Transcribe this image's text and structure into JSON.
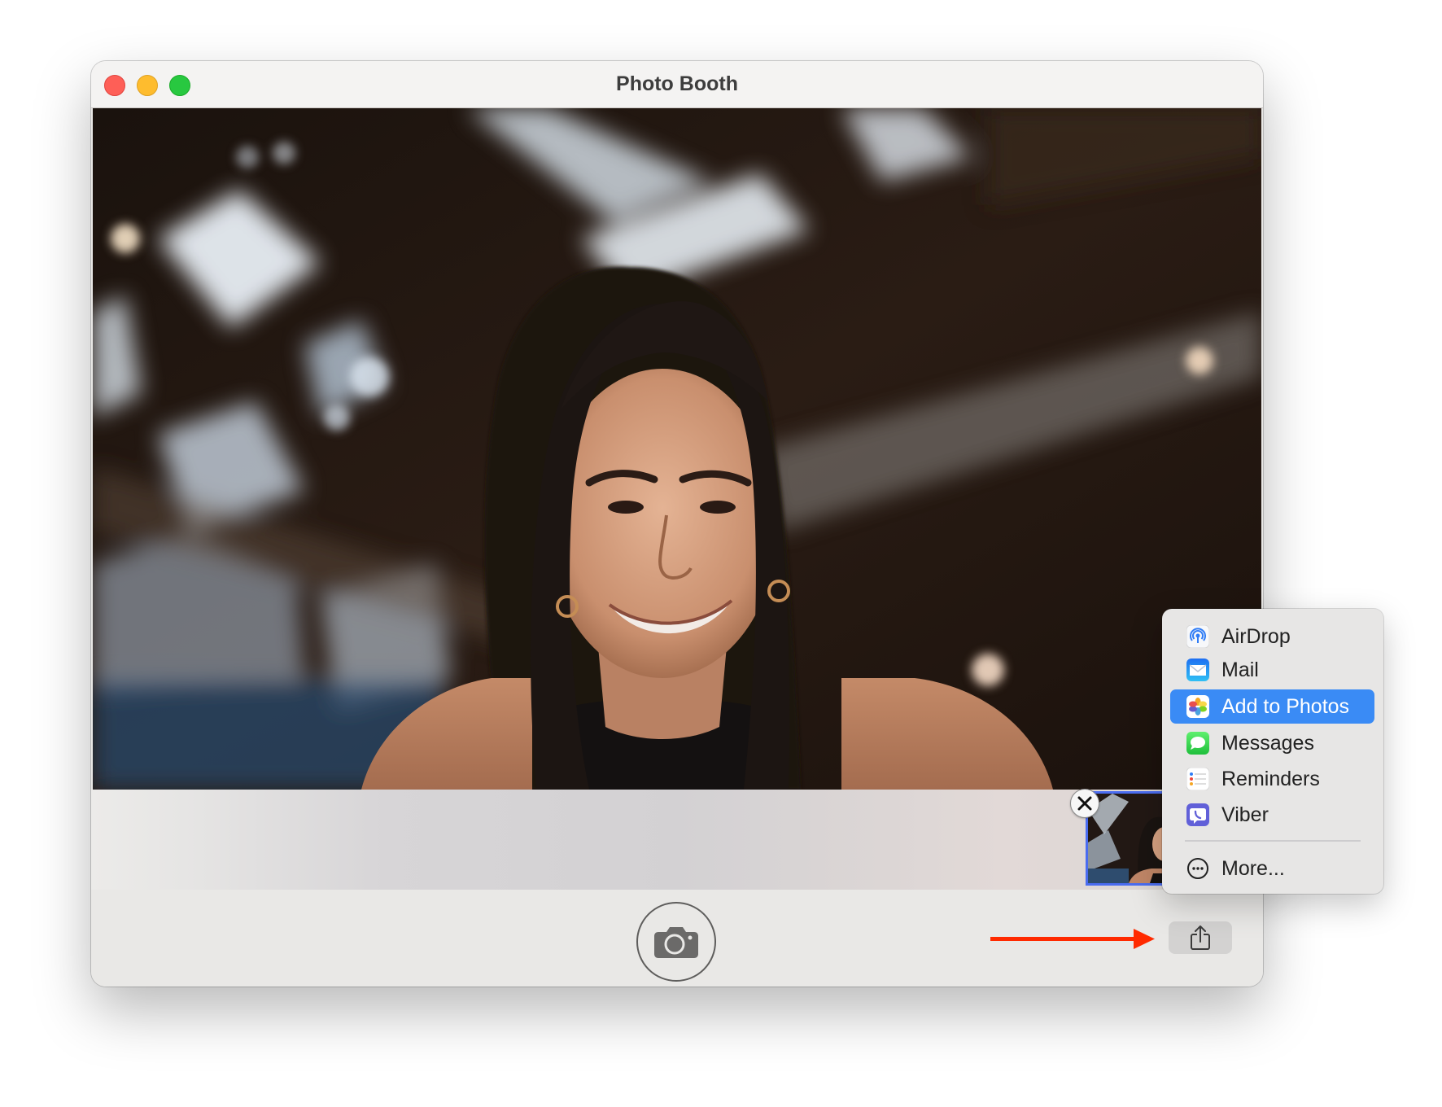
{
  "window": {
    "title": "Photo Booth",
    "controls": [
      "close",
      "minimize",
      "maximize"
    ]
  },
  "photo": {
    "description": "Live camera preview of a smiling woman with long dark hair in an industrial loft"
  },
  "filmstrip": {
    "thumbnail_selected": true,
    "remove_icon": "close-x-icon"
  },
  "toolbar": {
    "shutter_icon": "camera-icon",
    "share_icon": "share-icon"
  },
  "annotation": {
    "arrow_color": "#ff2a00",
    "points_to": "share-button"
  },
  "share_menu": {
    "items": [
      {
        "label": "AirDrop",
        "icon": "airdrop-icon",
        "selected": false
      },
      {
        "label": "Mail",
        "icon": "mail-icon",
        "selected": false
      },
      {
        "label": "Add to Photos",
        "icon": "photos-icon",
        "selected": true
      },
      {
        "label": "Messages",
        "icon": "messages-icon",
        "selected": false
      },
      {
        "label": "Reminders",
        "icon": "reminders-icon",
        "selected": false
      },
      {
        "label": "Viber",
        "icon": "viber-icon",
        "selected": false
      }
    ],
    "more_label": "More...",
    "more_icon": "ellipsis-circle-icon",
    "highlight_color": "#3a8bf5"
  }
}
